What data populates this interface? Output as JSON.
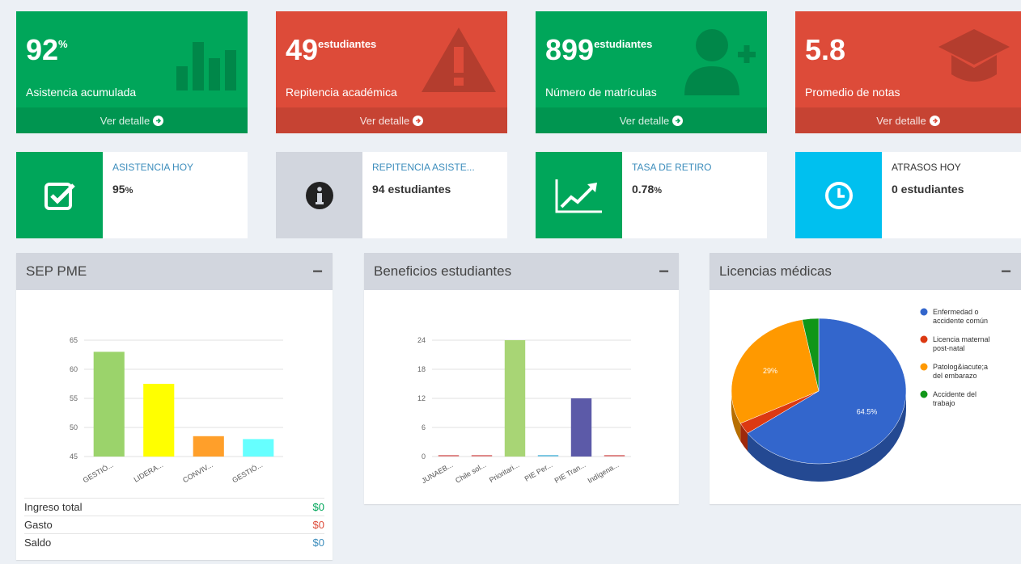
{
  "tiles": [
    {
      "value": "92",
      "unit": "%",
      "label": "Asistencia acumulada",
      "footer": "Ver detalle",
      "color": "#00a65a",
      "icon": "bar-chart-icon"
    },
    {
      "value": "49",
      "unit": "estudiantes",
      "label": "Repitencia académica",
      "footer": "Ver detalle",
      "color": "#dd4b39",
      "icon": "warning-icon"
    },
    {
      "value": "899",
      "unit": "estudiantes",
      "label": "Número de matrículas",
      "footer": "Ver detalle",
      "color": "#00a65a",
      "icon": "user-plus-icon"
    },
    {
      "value": "5.8",
      "unit": "",
      "label": "Promedio de notas",
      "footer": "Ver detalle",
      "color": "#dd4b39",
      "icon": "graduation-cap-icon"
    }
  ],
  "info_boxes": [
    {
      "title": "ASISTENCIA HOY",
      "value": "95",
      "unit": "%",
      "icon": "checkbox-icon",
      "color": "#00a65a"
    },
    {
      "title": "REPITENCIA ASISTE...",
      "value": "94 estudiantes",
      "unit": "",
      "icon": "info-icon",
      "color": "#d2d6de"
    },
    {
      "title": "TASA DE RETIRO",
      "value": "0.78",
      "unit": "%",
      "icon": "line-chart-icon",
      "color": "#00a65a"
    },
    {
      "title": "ATRASOS HOY",
      "value": "0 estudiantes",
      "unit": "",
      "icon": "clock-icon",
      "color": "#00c0ef"
    }
  ],
  "panels": {
    "sep": {
      "title": "SEP PME",
      "collapse": "−"
    },
    "beneficios": {
      "title": "Beneficios estudiantes",
      "collapse": "−"
    },
    "licencias": {
      "title": "Licencias médicas",
      "collapse": "−"
    }
  },
  "summary": [
    {
      "label": "Ingreso total",
      "value": "$0",
      "color": "#00a65a"
    },
    {
      "label": "Gasto",
      "value": "$0",
      "color": "#dd4b39"
    },
    {
      "label": "Saldo",
      "value": "$0",
      "color": "#3c8dbc"
    }
  ],
  "chart_data": [
    {
      "type": "bar",
      "categories": [
        "GESTIÓ...",
        "LIDERA...",
        "CONVIV...",
        "GESTIÓ..."
      ],
      "values": [
        63,
        57.5,
        48.5,
        48
      ],
      "colors": [
        "#9bd36b",
        "#ffff00",
        "#ff9f2a",
        "#66ffff"
      ],
      "yticks": [
        "45",
        "50",
        "55",
        "60",
        "65"
      ],
      "ylim": [
        45,
        65
      ],
      "grid": true
    },
    {
      "type": "bar",
      "categories": [
        "JUNAEB...",
        "Chile sol...",
        "Prioritari...",
        "PIE Per...",
        "PIE Tran...",
        "Indígena..."
      ],
      "values": [
        0,
        0,
        24,
        0,
        12,
        0
      ],
      "colors": [
        "#e08a8a",
        "#e08a8a",
        "#a8d575",
        "#7ec8e3",
        "#5c5aa8",
        "#e08a8a"
      ],
      "yticks": [
        "0",
        "6",
        "12",
        "18",
        "24"
      ],
      "ylim": [
        0,
        24
      ],
      "grid": true
    },
    {
      "type": "pie",
      "labels": [
        "Enfermedad o accidente común",
        "Licencia maternal post-natal",
        "Patolog&iacute;a del embarazo",
        "Accidente del trabajo"
      ],
      "values": [
        64.5,
        2.5,
        29,
        3
      ],
      "slice_labels": [
        "64.5%",
        "",
        "29%",
        ""
      ],
      "colors": [
        "#3366cc",
        "#dc3912",
        "#ff9900",
        "#109618"
      ],
      "legend": "right"
    }
  ]
}
